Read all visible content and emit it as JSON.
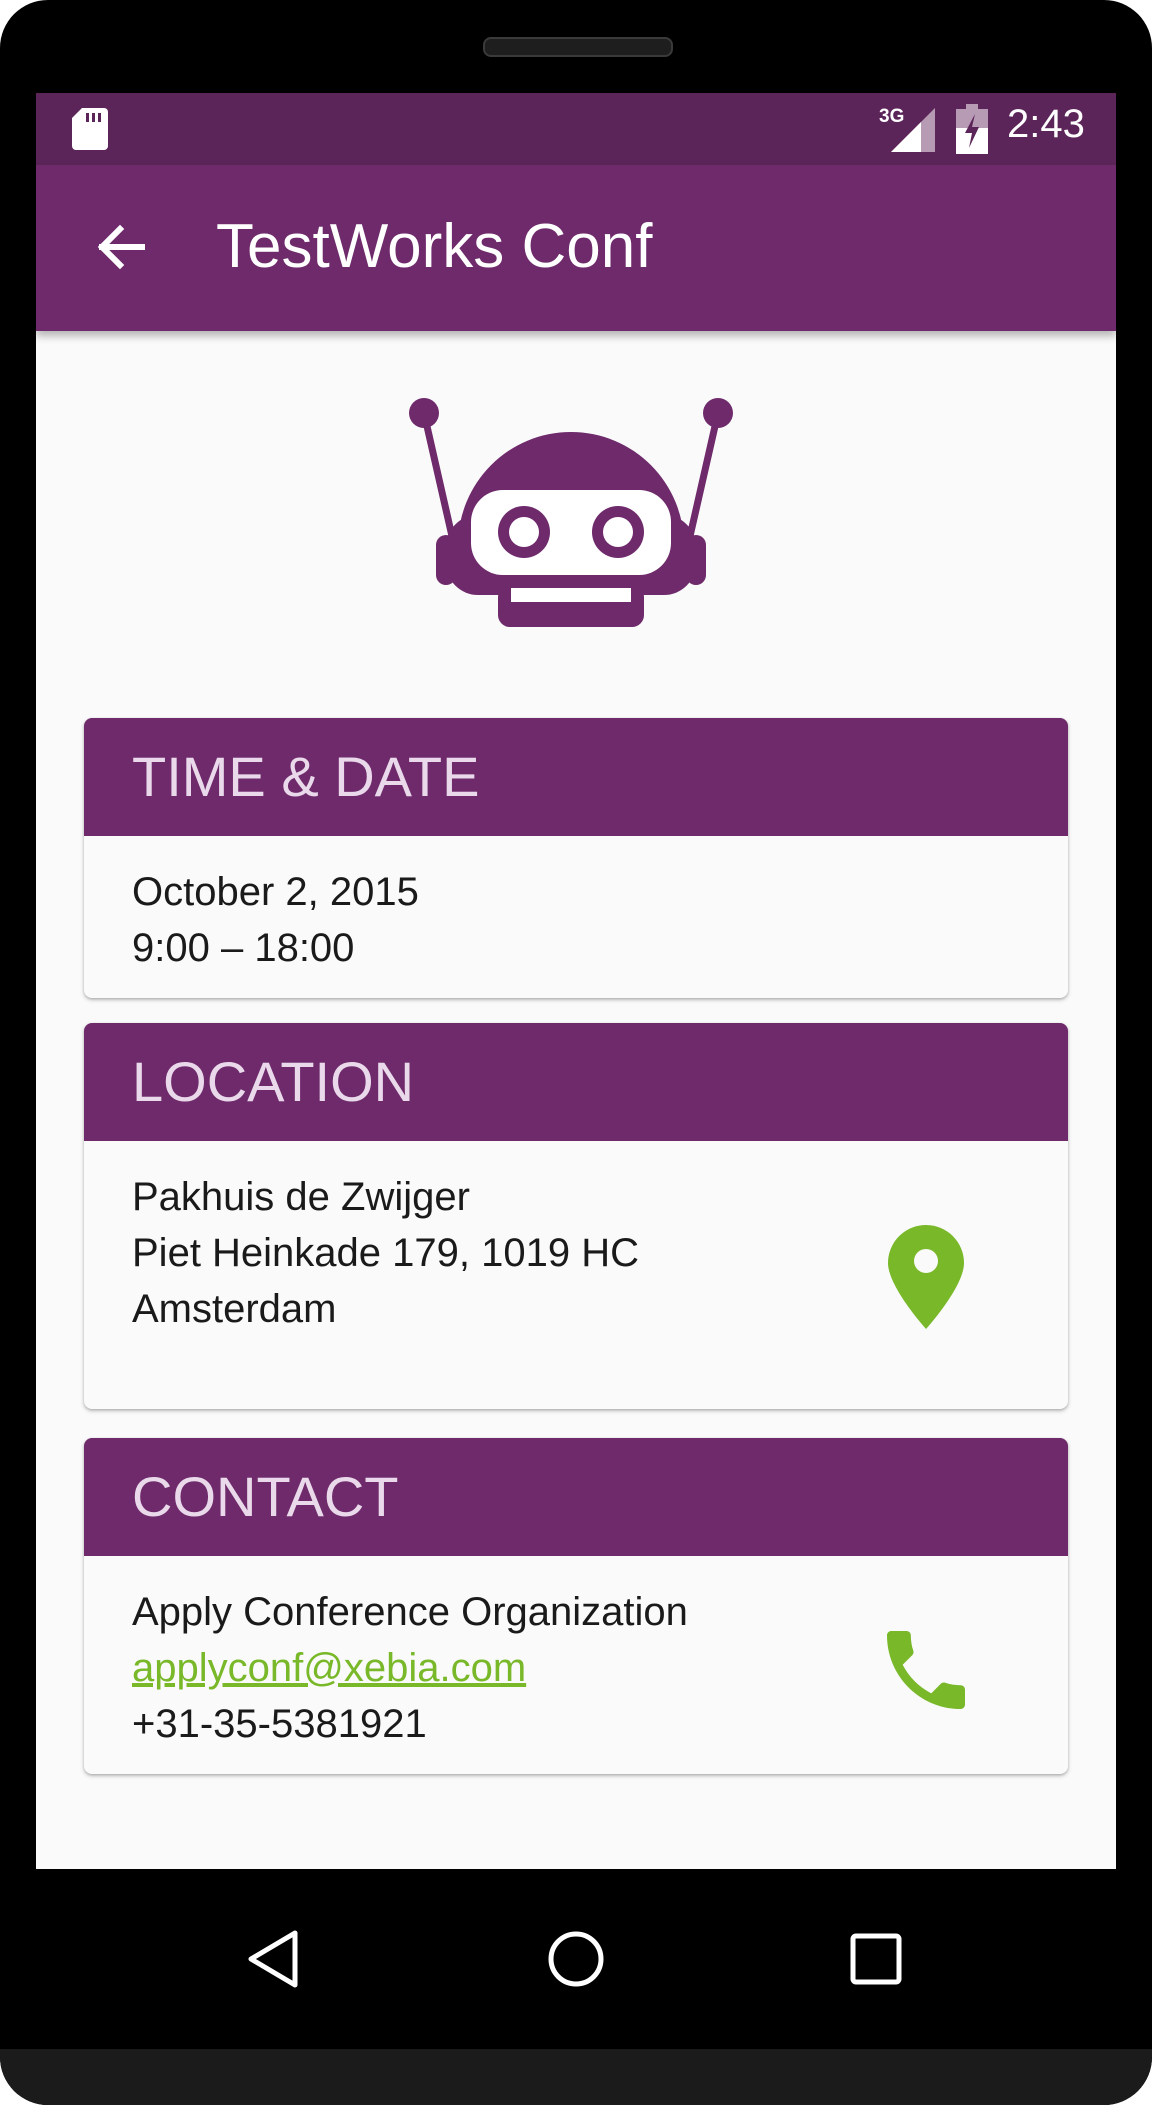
{
  "status_bar": {
    "network": "3G",
    "time": "2:43"
  },
  "app_bar": {
    "title": "TestWorks Conf"
  },
  "time_date": {
    "header": "TIME & DATE",
    "date": "October 2, 2015",
    "hours": "9:00 – 18:00"
  },
  "location": {
    "header": "LOCATION",
    "venue": "Pakhuis de Zwijger",
    "street": "Piet Heinkade 179, 1019 HC",
    "city": "Amsterdam"
  },
  "contact": {
    "header": "CONTACT",
    "organization": "Apply Conference Organization",
    "email": "applyconf@xebia.com",
    "phone": "+31-35-5381921"
  },
  "icons": {
    "back": "arrow-back-icon",
    "map": "map-pin-icon",
    "phone": "phone-icon",
    "logo": "robot-logo-icon"
  },
  "colors": {
    "primary": "#6e2a6b",
    "primary_dark": "#5c2559",
    "accent": "#78b829",
    "header_text": "#e9d9ea",
    "background": "#fafafa"
  }
}
